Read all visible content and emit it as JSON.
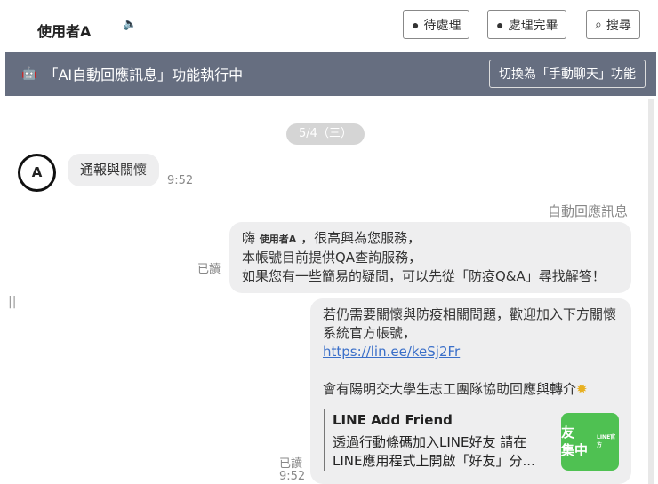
{
  "header": {
    "user_name": "使用者A",
    "speaker_icon": "speaker-icon",
    "buttons": [
      {
        "label": "待處理",
        "icon": "chat-bubble-icon"
      },
      {
        "label": "處理完畢",
        "icon": "check-bubble-icon"
      },
      {
        "label": "搜尋",
        "icon": "search-icon"
      }
    ]
  },
  "banner": {
    "text": "「AI自動回應訊息」功能執行中",
    "switch_label": "切換為「手動聊天」功能"
  },
  "chat": {
    "date": "5/4（三）",
    "avatar_letter": "A",
    "incoming": {
      "text": "通報與關懷",
      "time": "9:52"
    },
    "auto_label": "自動回應訊息",
    "msg1": {
      "greet": "嗨",
      "name": "使用者A",
      "line1_rest": "，很高興為您服務，",
      "line2": "本帳號目前提供QA查詢服務，",
      "line3": "如果您有一些簡易的疑問，可以先從「防疫Q&A」尋找解答！",
      "read": "已讀"
    },
    "msg2": {
      "line1": "若仍需要關懷與防疫相關問題，歡迎加入下方關懷系統官方帳號，",
      "link": "https://lin.ee/keSj2Fr",
      "line3": "會有陽明交大學生志工團隊協助回應與轉介",
      "read": "已讀",
      "time": "9:52",
      "card": {
        "title": "LINE Add Friend",
        "desc": "透過行動條碼加入LINE好友 請在LINE應用程式上開啟「好友」分...",
        "thumb_text": "友\n集中",
        "thumb_small": "LINE官方"
      }
    }
  }
}
